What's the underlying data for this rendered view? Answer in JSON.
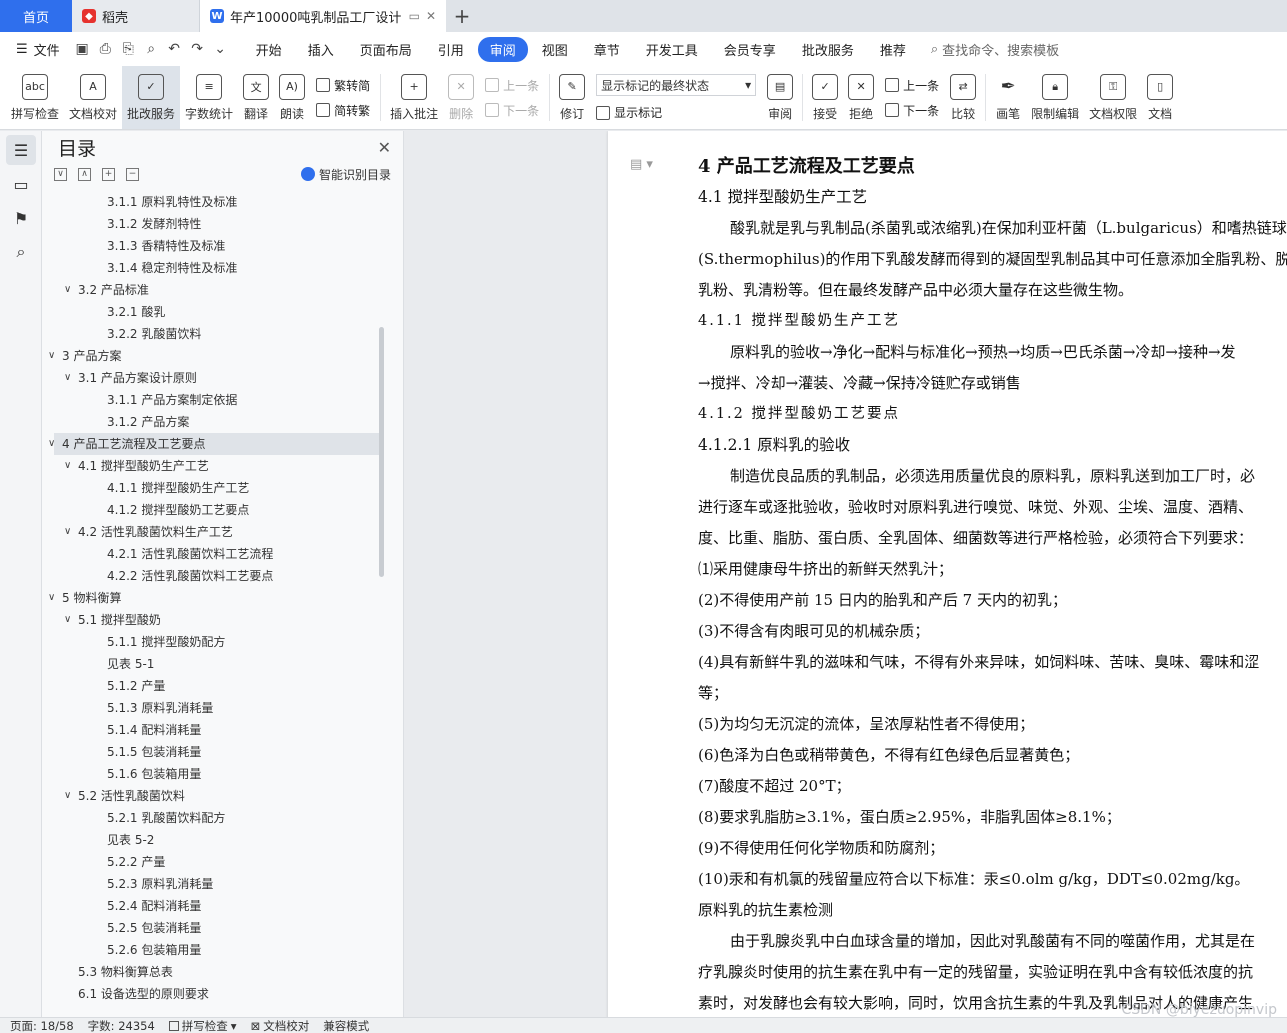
{
  "tabs": {
    "home": "首页",
    "daoke": "稻壳",
    "doc": "年产10000吨乳制品工厂设计"
  },
  "menubar": {
    "file": "文件",
    "items": [
      "开始",
      "插入",
      "页面布局",
      "引用",
      "审阅",
      "视图",
      "章节",
      "开发工具",
      "会员专享",
      "批改服务",
      "推荐"
    ],
    "active_index": 4,
    "search": "查找命令、搜索模板"
  },
  "ribbon": {
    "spell_check": "拼写检查",
    "doc_proof": "文档校对",
    "correction": "批改服务",
    "word_count": "字数统计",
    "translate": "翻译",
    "read_aloud": "朗读",
    "trad_to_simp": "繁转简",
    "simp_to_trad": "简转繁",
    "insert_comment": "插入批注",
    "delete": "删除",
    "prev": "上一条",
    "next": "下一条",
    "track": "修订",
    "markup_select": "显示标记的最终状态",
    "show_markup": "显示标记",
    "review": "审阅",
    "accept": "接受",
    "reject": "拒绝",
    "prev2": "上一条",
    "next2": "下一条",
    "compare": "比较",
    "pen": "画笔",
    "restrict_edit": "限制编辑",
    "doc_permission": "文档权限",
    "doc_more": "文档"
  },
  "toc": {
    "title": "目录",
    "ai_label": "智能识别目录",
    "items": [
      {
        "label": "3.1.1  原料乳特性及标准",
        "level": 3
      },
      {
        "label": "3.1.2  发酵剂特性",
        "level": 3
      },
      {
        "label": "3.1.3  香精特性及标准",
        "level": 3
      },
      {
        "label": "3.1.4  稳定剂特性及标准",
        "level": 3
      },
      {
        "label": "3.2  产品标准",
        "level": 2,
        "caret": "∨"
      },
      {
        "label": "3.2.1  酸乳",
        "level": 3
      },
      {
        "label": "3.2.2  乳酸菌饮料",
        "level": 3
      },
      {
        "label": "3  产品方案",
        "level": 1,
        "caret": "∨"
      },
      {
        "label": "3.1  产品方案设计原则",
        "level": 2,
        "caret": "∨"
      },
      {
        "label": "3.1.1  产品方案制定依据",
        "level": 3
      },
      {
        "label": "3.1.2  产品方案",
        "level": 3
      },
      {
        "label": "4  产品工艺流程及工艺要点",
        "level": 1,
        "caret": "∨",
        "selected": true
      },
      {
        "label": "4.1  搅拌型酸奶生产工艺",
        "level": 2,
        "caret": "∨"
      },
      {
        "label": "4.1.1  搅拌型酸奶生产工艺",
        "level": 3
      },
      {
        "label": "4.1.2  搅拌型酸奶工艺要点",
        "level": 3
      },
      {
        "label": "4.2  活性乳酸菌饮料生产工艺",
        "level": 2,
        "caret": "∨"
      },
      {
        "label": "4.2.1  活性乳酸菌饮料工艺流程",
        "level": 3
      },
      {
        "label": "4.2.2  活性乳酸菌饮料工艺要点",
        "level": 3
      },
      {
        "label": "5  物料衡算",
        "level": 1,
        "caret": "∨"
      },
      {
        "label": "5.1  搅拌型酸奶",
        "level": 2,
        "caret": "∨"
      },
      {
        "label": "5.1.1  搅拌型酸奶配方",
        "level": 3
      },
      {
        "label": "见表 5-1",
        "level": 3
      },
      {
        "label": "5.1.2  产量",
        "level": 3
      },
      {
        "label": "5.1.3  原料乳消耗量",
        "level": 3
      },
      {
        "label": "5.1.4  配料消耗量",
        "level": 3
      },
      {
        "label": "5.1.5  包装消耗量",
        "level": 3
      },
      {
        "label": "5.1.6  包装箱用量",
        "level": 3
      },
      {
        "label": "5.2  活性乳酸菌饮料",
        "level": 2,
        "caret": "∨"
      },
      {
        "label": "5.2.1  乳酸菌饮料配方",
        "level": 3
      },
      {
        "label": "见表 5-2",
        "level": 3
      },
      {
        "label": "5.2.2  产量",
        "level": 3
      },
      {
        "label": "5.2.3  原料乳消耗量",
        "level": 3
      },
      {
        "label": "5.2.4  配料消耗量",
        "level": 3
      },
      {
        "label": "5.2.5  包装消耗量",
        "level": 3
      },
      {
        "label": "5.2.6  包装箱用量",
        "level": 3
      },
      {
        "label": "5.3  物料衡算总表",
        "level": 2
      },
      {
        "label": "6.1  设备选型的原则要求",
        "level": 2
      }
    ]
  },
  "document": {
    "lines": [
      {
        "cls": "h1",
        "text": "4  产品工艺流程及工艺要点"
      },
      {
        "cls": "h2",
        "text": "4.1  搅拌型酸奶生产工艺"
      },
      {
        "cls": "indent",
        "text": "酸乳就是乳与乳制品(杀菌乳或浓缩乳)在保加利亚杆菌（L.bulgaricus）和嗜热链球"
      },
      {
        "cls": "",
        "text": "(S.thermophilus)的作用下乳酸发酵而得到的凝固型乳制品其中可任意添加全脂乳粉、脱"
      },
      {
        "cls": "",
        "text": "乳粉、乳清粉等。但在最终发酵产品中必须大量存在这些微生物。"
      },
      {
        "cls": "h3k",
        "text": "4.1.1  搅拌型酸奶生产工艺"
      },
      {
        "cls": "indent",
        "text": "原料乳的验收→净化→配料与标准化→预热→均质→巴氏杀菌→冷却→接种→发"
      },
      {
        "cls": "",
        "text": "→搅拌、冷却→灌装、冷藏→保持冷链贮存或销售"
      },
      {
        "cls": "h3k",
        "text": "4.1.2  搅拌型酸奶工艺要点"
      },
      {
        "cls": "h2",
        "text": "4.1.2.1  原料乳的验收"
      },
      {
        "cls": "indent",
        "text": "制造优良品质的乳制品，必须选用质量优良的原料乳，原料乳送到加工厂时，必"
      },
      {
        "cls": "",
        "text": "进行逐车或逐批验收，验收时对原料乳进行嗅觉、味觉、外观、尘埃、温度、酒精、"
      },
      {
        "cls": "",
        "text": "度、比重、脂肪、蛋白质、全乳固体、细菌数等进行严格检验，必须符合下列要求："
      },
      {
        "cls": "",
        "text": "⑴采用健康母牛挤出的新鲜天然乳汁；"
      },
      {
        "cls": "",
        "text": "(2)不得使用产前 15 日内的胎乳和产后 7 天内的初乳；"
      },
      {
        "cls": "",
        "text": "(3)不得含有肉眼可见的机械杂质；"
      },
      {
        "cls": "",
        "text": "(4)具有新鲜牛乳的滋味和气味，不得有外来异味，如饲料味、苦味、臭味、霉味和涩"
      },
      {
        "cls": "",
        "text": "等；"
      },
      {
        "cls": "",
        "text": "(5)为均匀无沉淀的流体，呈浓厚粘性者不得使用；"
      },
      {
        "cls": "",
        "text": "(6)色泽为白色或稍带黄色，不得有红色绿色后显著黄色；"
      },
      {
        "cls": "",
        "text": "(7)酸度不超过 20°T；"
      },
      {
        "cls": "",
        "text": "(8)要求乳脂肪≥3.1%，蛋白质≥2.95%，非脂乳固体≥8.1%；"
      },
      {
        "cls": "",
        "text": "(9)不得使用任何化学物质和防腐剂；"
      },
      {
        "cls": "",
        "text": "(10)汞和有机氯的残留量应符合以下标准：汞≤0.olm g/kg，DDT≤0.02mg/kg。"
      },
      {
        "cls": "",
        "text": "原料乳的抗生素检测"
      },
      {
        "cls": "indent",
        "text": "由于乳腺炎乳中白血球含量的增加，因此对乳酸菌有不同的噬菌作用，尤其是在"
      },
      {
        "cls": "",
        "text": "疗乳腺炎时使用的抗生素在乳中有一定的残留量，实验证明在乳中含有较低浓度的抗"
      },
      {
        "cls": "",
        "text": "素时，对发酵也会有较大影响，同时，饮用含抗生素的牛乳及乳制品对人的健康产生"
      }
    ]
  },
  "status": {
    "page": "页面: 18/58",
    "words": "字数: 24354",
    "spell": "拼写检查",
    "proof": "文档校对",
    "compat": "兼容模式"
  },
  "watermark": "CSDN @biyezuopinvip",
  "colors": {
    "accent": "#2f6fed",
    "daoke_logo": "#e6322e",
    "wps_logo": "#2f6fed"
  }
}
